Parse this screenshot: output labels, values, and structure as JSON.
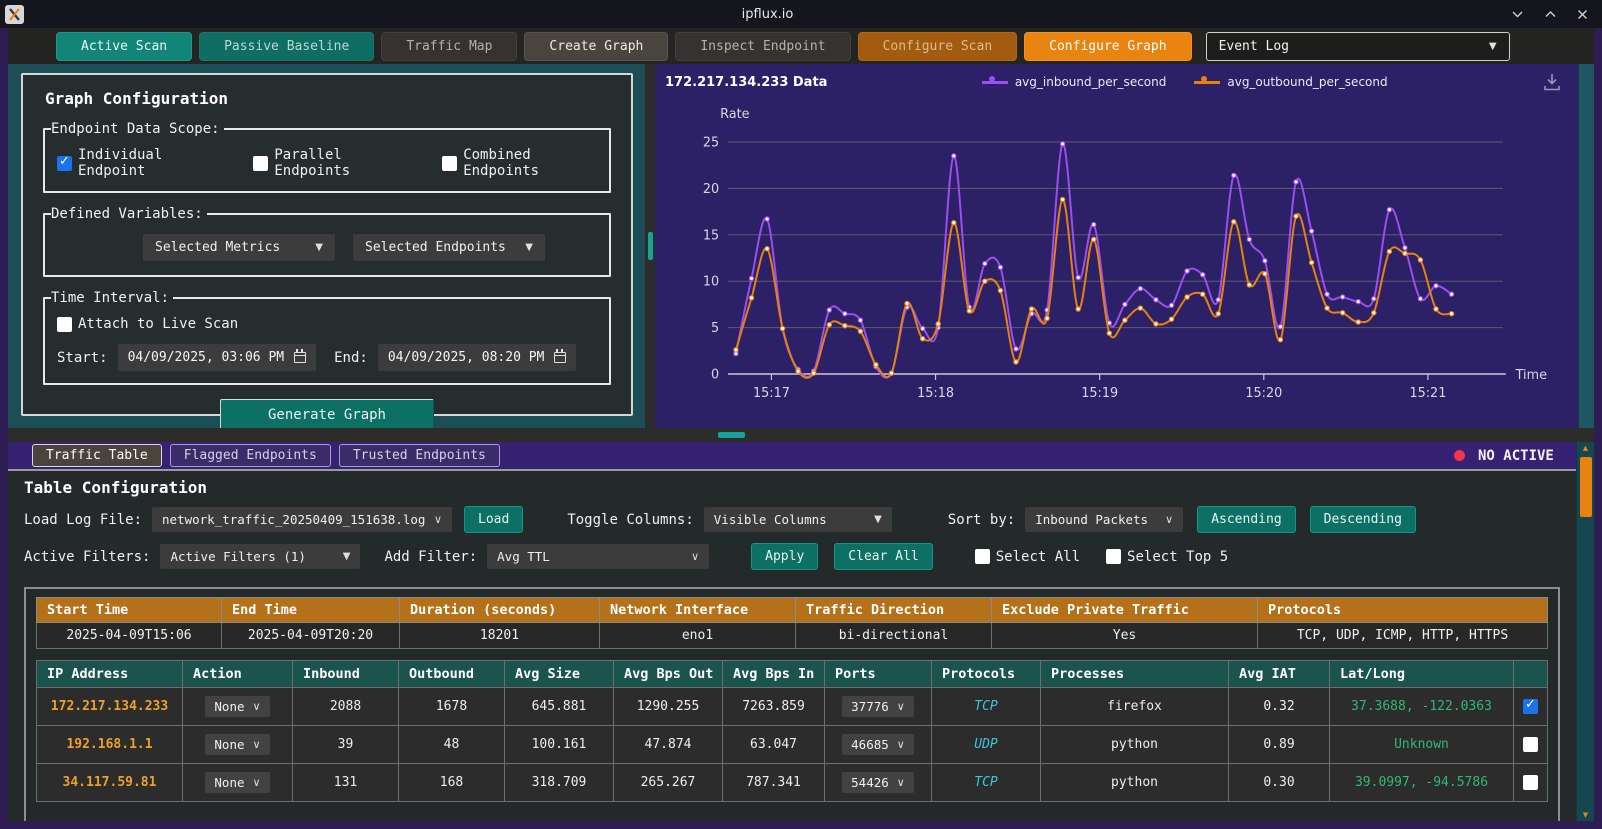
{
  "window": {
    "title": "ipflux.io"
  },
  "colors": {
    "accent_teal": "#128578",
    "accent_orange": "#ea8410",
    "chart_bg": "#2c2066",
    "status_red": "#f5334a",
    "ip_orange": "#f0a028",
    "protocol_cyan": "#38c8dc",
    "latlong_green": "#30b878",
    "checkbox_blue": "#1a73e8",
    "scroll_thumb_orange": "#e8830f"
  },
  "icons": {
    "app": "x-logo",
    "minimize": "chevron-down",
    "maximize": "chevron-up",
    "close": "x",
    "download": "download-tray-arrow",
    "calendar": "calendar-box",
    "dropdown_bold": "▼",
    "dropdown_thin": "∨"
  },
  "tabbar": {
    "tabs": [
      "Active Scan",
      "Passive Baseline",
      "Traffic Map",
      "Create Graph",
      "Inspect Endpoint",
      "Configure Scan",
      "Configure Graph"
    ],
    "active_tab": "Active Scan",
    "event_log_label": "Event Log"
  },
  "graph_config": {
    "title": "Graph Configuration",
    "scope": {
      "legend": "Endpoint Data Scope:",
      "options": [
        {
          "label": "Individual Endpoint",
          "checked": true
        },
        {
          "label": "Parallel Endpoints",
          "checked": false
        },
        {
          "label": "Combined Endpoints",
          "checked": false
        }
      ]
    },
    "variables": {
      "legend": "Defined Variables:",
      "dropdowns": [
        "Selected Metrics",
        "Selected Endpoints"
      ]
    },
    "time": {
      "legend": "Time Interval:",
      "live_label": "Attach to Live Scan",
      "live_checked": false,
      "start_label": "Start:",
      "start_value": "04/09/2025, 03:06 PM",
      "end_label": "End:",
      "end_value": "04/09/2025, 08:20 PM"
    },
    "generate_label": "Generate Graph"
  },
  "chart_data": {
    "type": "line",
    "title": "172.217.134.233 Data",
    "xlabel": "Time",
    "ylabel": "Rate",
    "x_ticks": [
      "15:17",
      "15:18",
      "15:19",
      "15:20",
      "15:21"
    ],
    "y_ticks": [
      0,
      5,
      10,
      15,
      20,
      25
    ],
    "ylim": [
      0,
      25
    ],
    "grid": true,
    "legend_position": "top-center",
    "series": [
      {
        "name": "avg_inbound_per_second",
        "color": "#9b4ff0",
        "values": [
          2.2,
          10.3,
          16.7,
          4.9,
          0.5,
          0.3,
          6.9,
          6.5,
          5.8,
          0.8,
          0.1,
          7.2,
          4.9,
          5.0,
          23.5,
          7.2,
          11.9,
          11.5,
          2.7,
          6.5,
          6.9,
          24.8,
          10.4,
          16.1,
          5.5,
          7.5,
          9.2,
          8.0,
          7.4,
          11.1,
          10.7,
          8.0,
          21.4,
          14.5,
          12.2,
          5.1,
          20.7,
          15.4,
          8.6,
          8.3,
          7.8,
          8.1,
          17.7,
          13.6,
          8.1,
          9.5,
          8.6
        ]
      },
      {
        "name": "avg_outbound_per_second",
        "color": "#e8820e",
        "values": [
          2.6,
          8.2,
          13.5,
          4.9,
          0.3,
          0.1,
          5.3,
          5.2,
          4.6,
          1.0,
          0.1,
          7.6,
          3.8,
          5.4,
          16.3,
          6.8,
          10.0,
          9.0,
          1.3,
          7.0,
          6.0,
          18.8,
          7.0,
          14.5,
          4.4,
          5.8,
          7.1,
          5.4,
          5.9,
          8.3,
          8.6,
          6.5,
          16.4,
          9.6,
          10.8,
          3.7,
          17.0,
          12.0,
          7.1,
          6.6,
          5.6,
          6.6,
          13.2,
          13.0,
          12.3,
          7.0,
          6.5
        ]
      }
    ]
  },
  "bottom": {
    "tabs": [
      "Traffic Table",
      "Flagged Endpoints",
      "Trusted Endpoints"
    ],
    "active_tab": "Traffic Table",
    "status_label": "NO ACTIVE SCAN"
  },
  "table_config": {
    "title": "Table Configuration",
    "load_label": "Load Log File:",
    "load_value": "network_traffic_20250409_151638.log",
    "load_button": "Load",
    "toggle_label": "Toggle Columns:",
    "toggle_value": "Visible Columns",
    "sort_label": "Sort by:",
    "sort_value": "Inbound Packets",
    "asc_button": "Ascending",
    "desc_button": "Descending",
    "filters_label": "Active Filters:",
    "filters_value": "Active Filters (1)",
    "add_filter_label": "Add Filter:",
    "add_filter_value": "Avg TTL",
    "apply_button": "Apply",
    "clear_button": "Clear All",
    "select_all_label": "Select All",
    "select_top_label": "Select Top 5"
  },
  "scan_summary": {
    "columns": [
      "Start Time",
      "End Time",
      "Duration (seconds)",
      "Network Interface",
      "Traffic Direction",
      "Exclude Private Traffic",
      "Protocols"
    ],
    "row": [
      "2025-04-09T15:06",
      "2025-04-09T20:20",
      "18201",
      "eno1",
      "bi-directional",
      "Yes",
      "TCP, UDP, ICMP, HTTP, HTTPS"
    ]
  },
  "traffic_table": {
    "columns": [
      "IP Address",
      "Action",
      "Inbound",
      "Outbound",
      "Avg Size",
      "Avg Bps Out",
      "Avg Bps In",
      "Ports",
      "Protocols",
      "Processes",
      "Avg IAT",
      "Lat/Long"
    ],
    "rows": [
      {
        "ip": "172.217.134.233",
        "action": "None",
        "inbound": "2088",
        "outbound": "1678",
        "avg_size": "645.881",
        "avg_bps_out": "1290.255",
        "avg_bps_in": "7263.859",
        "port": "37776",
        "protocol": "TCP",
        "process": "firefox",
        "avg_iat": "0.32",
        "lat_long": "37.3688, -122.0363",
        "selected": true
      },
      {
        "ip": "192.168.1.1",
        "action": "None",
        "inbound": "39",
        "outbound": "48",
        "avg_size": "100.161",
        "avg_bps_out": "47.874",
        "avg_bps_in": "63.047",
        "port": "46685",
        "protocol": "UDP",
        "process": "python",
        "avg_iat": "0.89",
        "lat_long": "Unknown",
        "selected": false
      },
      {
        "ip": "34.117.59.81",
        "action": "None",
        "inbound": "131",
        "outbound": "168",
        "avg_size": "318.709",
        "avg_bps_out": "265.267",
        "avg_bps_in": "787.341",
        "port": "54426",
        "protocol": "TCP",
        "process": "python",
        "avg_iat": "0.30",
        "lat_long": "39.0997, -94.5786",
        "selected": false
      }
    ]
  }
}
